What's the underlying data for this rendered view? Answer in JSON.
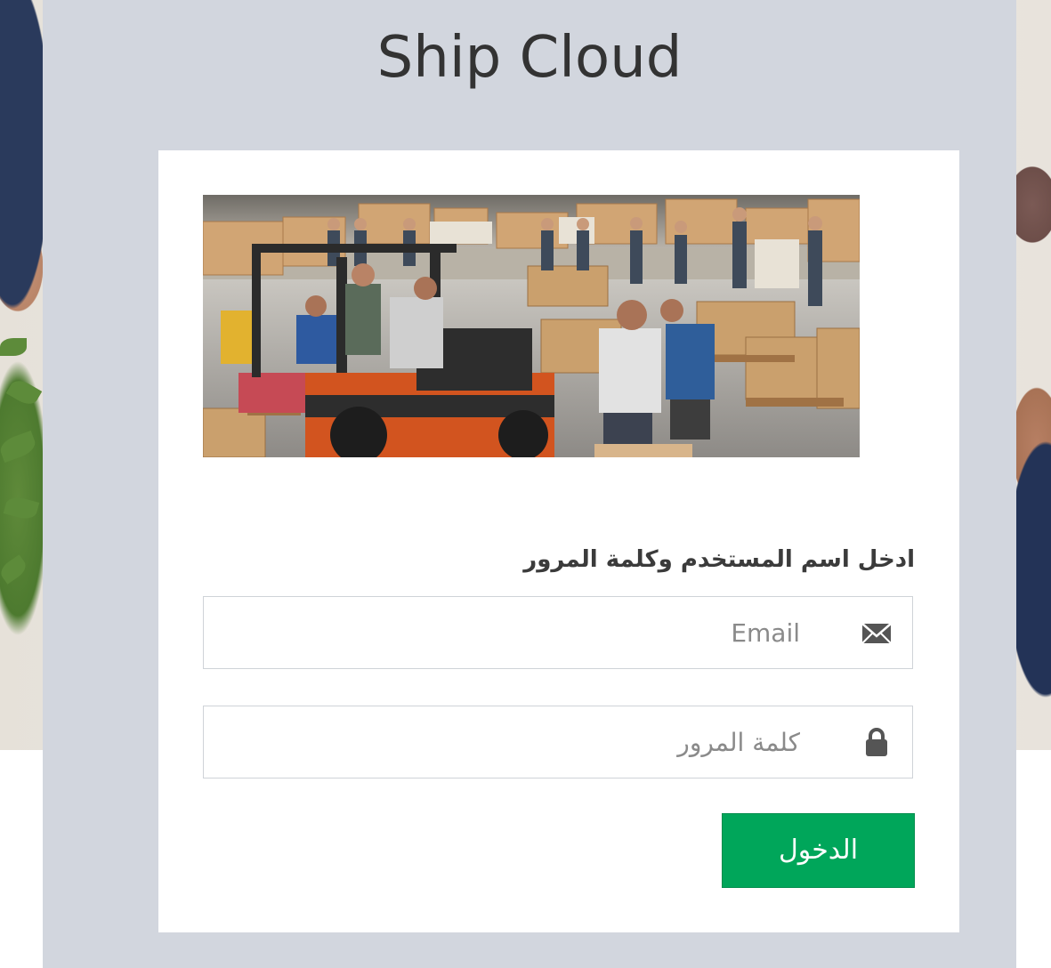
{
  "app": {
    "title": "Ship Cloud"
  },
  "hero_image": {
    "alt": "warehouse-forklift-photo"
  },
  "login_form": {
    "instruction": "ادخل اسم المستخدم وكلمة المرور",
    "email_placeholder": "Email",
    "email_value": "",
    "email_icon": "envelope-icon",
    "password_placeholder": "كلمة المرور",
    "password_value": "",
    "password_icon": "lock-icon",
    "submit_label": "الدخول"
  },
  "colors": {
    "page_panel": "#d2d6de",
    "card": "#ffffff",
    "primary_button": "#00a65a",
    "title_text": "#333333"
  }
}
